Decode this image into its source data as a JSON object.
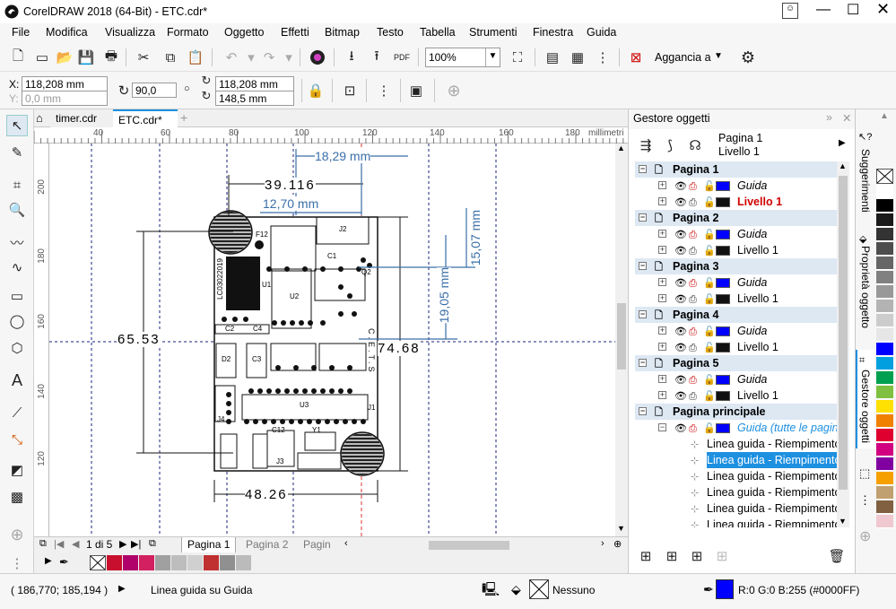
{
  "title": "CorelDRAW 2018 (64-Bit) - ETC.cdr*",
  "menu": [
    "File",
    "Modifica",
    "Visualizza",
    "Formato",
    "Oggetto",
    "Effetti",
    "Bitmap",
    "Testo",
    "Tabella",
    "Strumenti",
    "Finestra",
    "Guida"
  ],
  "toolbar": {
    "zoom": "100%",
    "snap": "Aggancia a"
  },
  "props": {
    "x": "118,208 mm",
    "y": "0,0 mm",
    "rotation": "90,0",
    "pos_x": "118,208 mm",
    "pos_y": "148,5 mm"
  },
  "tabs": [
    "timer.cdr",
    "ETC.cdr*"
  ],
  "ruler": {
    "h": [
      "40",
      "60",
      "80",
      "100",
      "120",
      "140",
      "160",
      "180"
    ],
    "v": [
      "200",
      "180",
      "160",
      "140",
      "120"
    ],
    "unit": "millimetri"
  },
  "drawing": {
    "dims": [
      "39.116",
      "18,29 mm",
      "12,70 mm",
      "15,07 mm",
      "19,05 mm",
      "65.53",
      "74.68",
      "48.26"
    ],
    "labels": [
      "F12",
      "J2",
      "U1",
      "U2",
      "U3",
      "LC03022019",
      "C.E.T.S",
      "Q2",
      "C1",
      "C2",
      "C3",
      "C4",
      "D2",
      "C12",
      "Y1",
      "J3",
      "J4",
      "J1"
    ]
  },
  "pagenav": {
    "count": "1 di 5",
    "pages": [
      "Pagina 1",
      "Pagina 2",
      "Pagin"
    ]
  },
  "status": {
    "coords": "( 186,770; 185,194 )",
    "msg": "Linea guida su Guida",
    "fill": "Nessuno",
    "color": "R:0 G:0 B:255 (#0000FF)"
  },
  "dock": {
    "title": "Gestore oggetti",
    "page": "Pagina 1",
    "layer": "Livello 1",
    "rows": [
      {
        "t": "page",
        "label": "Pagina 1"
      },
      {
        "t": "guide",
        "label": "Guida"
      },
      {
        "t": "layer",
        "label": "Livello 1",
        "red": true
      },
      {
        "t": "page",
        "label": "Pagina 2"
      },
      {
        "t": "guide",
        "label": "Guida"
      },
      {
        "t": "layer",
        "label": "Livello 1"
      },
      {
        "t": "page",
        "label": "Pagina 3"
      },
      {
        "t": "guide",
        "label": "Guida"
      },
      {
        "t": "layer",
        "label": "Livello 1"
      },
      {
        "t": "page",
        "label": "Pagina 4"
      },
      {
        "t": "guide",
        "label": "Guida"
      },
      {
        "t": "layer",
        "label": "Livello 1"
      },
      {
        "t": "page",
        "label": "Pagina 5"
      },
      {
        "t": "guide",
        "label": "Guida"
      },
      {
        "t": "layer",
        "label": "Livello 1"
      },
      {
        "t": "page",
        "label": "Pagina principale"
      },
      {
        "t": "master",
        "label": "Guida (tutte le pagine)"
      },
      {
        "t": "line",
        "label": "Linea guida - Riempimento"
      },
      {
        "t": "line",
        "label": "Linea guida - Riempimento",
        "sel": true
      },
      {
        "t": "line",
        "label": "Linea guida - Riempimento"
      },
      {
        "t": "line",
        "label": "Linea guida - Riempimento"
      },
      {
        "t": "line",
        "label": "Linea guida - Riempimento"
      },
      {
        "t": "line",
        "label": "Linea guida - Riempimento"
      }
    ]
  },
  "side_tabs": [
    "Suggerimenti",
    "Proprietà oggetto",
    "Gestore oggetti"
  ],
  "colors": {
    "accent": "#1e90e0",
    "guide": "#0000ff",
    "page_row": "#dde8f3"
  },
  "palette": [
    "#ffffff",
    "#000000",
    "#1a1a1a",
    "#333333",
    "#4d4d4d",
    "#666666",
    "#808080",
    "#999999",
    "#b3b3b3",
    "#cccccc",
    "#e6e6e6",
    "#0000ff",
    "#00a0e0",
    "#00a050",
    "#80c040",
    "#ffe000",
    "#f08000",
    "#e00030",
    "#d00080",
    "#8000a0",
    "#f6a000",
    "#c0a070",
    "#806040",
    "#f0c8d0"
  ],
  "mini_palette": [
    "#c8102e",
    "#b0006a",
    "#d22060",
    "#a0a0a0",
    "#bdbdbd",
    "#d0d0d0",
    "#c03030",
    "#909090",
    "#bbbbbb"
  ]
}
